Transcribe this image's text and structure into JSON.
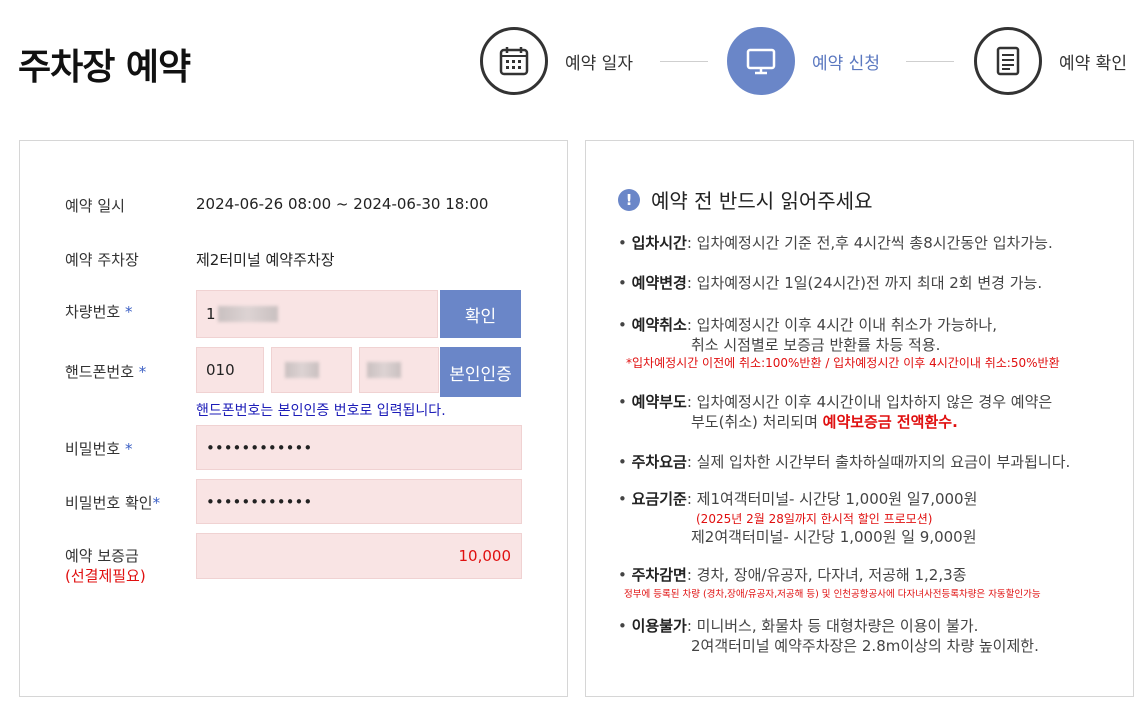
{
  "page_title": "주차장 예약",
  "steps": [
    {
      "label": "예약 일자",
      "icon": "calendar-icon",
      "active": false
    },
    {
      "label": "예약 신청",
      "icon": "monitor-icon",
      "active": true
    },
    {
      "label": "예약 확인",
      "icon": "document-icon",
      "active": false
    }
  ],
  "colors": {
    "accent": "#6a86c8",
    "field_bg": "#f9e4e4",
    "warning": "#e01010",
    "hint": "#1d1db8"
  },
  "form": {
    "date_label": "예약 일시",
    "date_value": "2024-06-26 08:00 ~ 2024-06-30 18:00",
    "lot_label": "예약 주차장",
    "lot_value": "제2터미널 예약주차장",
    "car_label": "차량번호",
    "car_value_prefix": "1",
    "car_confirm_button": "확인",
    "phone_label": "핸드폰번호",
    "phone_part1": "010",
    "phone_verify_button": "본인인증",
    "phone_hint": "핸드폰번호는 본인인증 번호로 입력됩니다.",
    "password_label": "비밀번호",
    "password_value": "••••••••••••",
    "password_confirm_label": "비밀번호 확인",
    "password_confirm_value": "••••••••••••",
    "deposit_label": "예약 보증금",
    "deposit_note": "(선결제필요)",
    "deposit_value": "10,000",
    "required_mark": "*"
  },
  "notice": {
    "title": "예약 전 반드시 읽어주세요",
    "icon": "exclamation-icon",
    "rules": {
      "entry_key": "입차시간",
      "entry_text": ": 입차예정시간 기준 전,후 4시간씩 총8시간동안 입차가능.",
      "change_key": "예약변경",
      "change_text": ": 입차예정시간 1일(24시간)전 까지 최대 2회 변경 가능.",
      "cancel_key": "예약취소",
      "cancel_text": ": 입차예정시간 이후 4시간 이내 취소가 가능하나,",
      "cancel_text2": "취소 시점별로 보증금 반환률 차등 적용.",
      "cancel_note": "*입차예정시간 이전에 취소:100%반환 / 입차예정시간 이후 4시간이내 취소:50%반환",
      "noshow_key": "예약부도",
      "noshow_text": ": 입차예정시간 이후 4시간이내 입차하지 않은 경우 예약은",
      "noshow_text2_a": "부도(취소) 처리되며 ",
      "noshow_text2_b": "예약보증금 전액환수.",
      "fee_key": "주차요금",
      "fee_text": ": 실제 입차한 시간부터 출차하실때까지의 요금이 부과됩니다.",
      "rate_key": "요금기준",
      "rate_text": ": 제1여객터미널- 시간당 1,000원 일7,000원",
      "rate_promo": "(2025년 2월 28일까지 한시적 할인 프로모션)",
      "rate_text2": "제2여객터미널- 시간당 1,000원 일 9,000원",
      "discount_key": "주차감면",
      "discount_text": ": 경차, 장애/유공자, 다자녀, 저공해 1,2,3종",
      "discount_note": "정부에 등록된 차량 (경차,장애/유공자,저공해 등) 및 인천공항공사에 다자녀사전등록차량은 자동할인가능",
      "unavailable_key": "이용불가",
      "unavailable_text": ": 미니버스, 화물차 등 대형차량은 이용이 불가.",
      "unavailable_text2": "2여객터미널 예약주차장은 2.8m이상의 차량 높이제한."
    }
  }
}
